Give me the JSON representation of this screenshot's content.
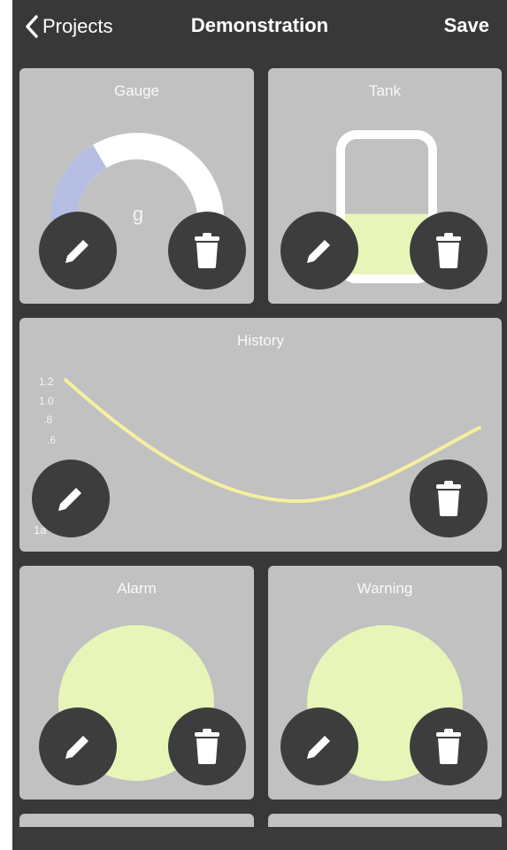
{
  "nav": {
    "back_label": "Projects",
    "title": "Demonstration",
    "save_label": "Save"
  },
  "widgets": {
    "gauge": {
      "label": "Gauge",
      "center_text": "g",
      "level": 0.33
    },
    "tank": {
      "label": "Tank",
      "level": 0.45
    },
    "history": {
      "label": "History",
      "y_ticks": [
        "1.2",
        "1.0",
        ".8",
        ".6"
      ],
      "bottom_label": "1a"
    },
    "alarm": {
      "label": "Alarm"
    },
    "warning": {
      "label": "Warning"
    }
  },
  "icons": {
    "edit": "pencil-icon",
    "delete": "trash-icon",
    "back": "chevron-left-icon"
  },
  "colors": {
    "background": "#383838",
    "card": "#c1c1c1",
    "button": "#3d3d3d",
    "gauge_fill": "#b6bde3",
    "gauge_track": "#ffffff",
    "indicator": "#e7f5b9",
    "history_line": "#f4f0a0"
  }
}
